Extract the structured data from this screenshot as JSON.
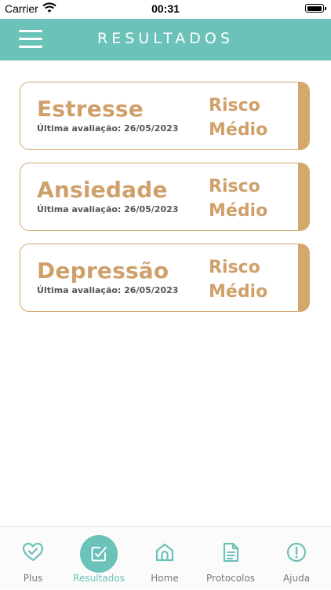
{
  "status_bar": {
    "carrier": "Carrier",
    "time": "00:31"
  },
  "header": {
    "title": "RESULTADOS"
  },
  "results": [
    {
      "name": "Estresse",
      "last_eval": "Última avaliação: 26/05/2023",
      "risk_line1": "Risco",
      "risk_line2": "Médio"
    },
    {
      "name": "Ansiedade",
      "last_eval": "Última avaliação: 26/05/2023",
      "risk_line1": "Risco",
      "risk_line2": "Médio"
    },
    {
      "name": "Depressão",
      "last_eval": "Última avaliação: 26/05/2023",
      "risk_line1": "Risco",
      "risk_line2": "Médio"
    }
  ],
  "tabs": [
    {
      "label": "Plus",
      "icon": "heart-check-icon"
    },
    {
      "label": "Resultados",
      "icon": "checkbox-edit-icon",
      "active": true
    },
    {
      "label": "Home",
      "icon": "home-icon"
    },
    {
      "label": "Protocolos",
      "icon": "document-icon"
    },
    {
      "label": "Ajuda",
      "icon": "alert-circle-icon"
    }
  ],
  "colors": {
    "teal": "#6bc2b8",
    "gold": "#cfa06a",
    "border": "#d4ab74"
  }
}
